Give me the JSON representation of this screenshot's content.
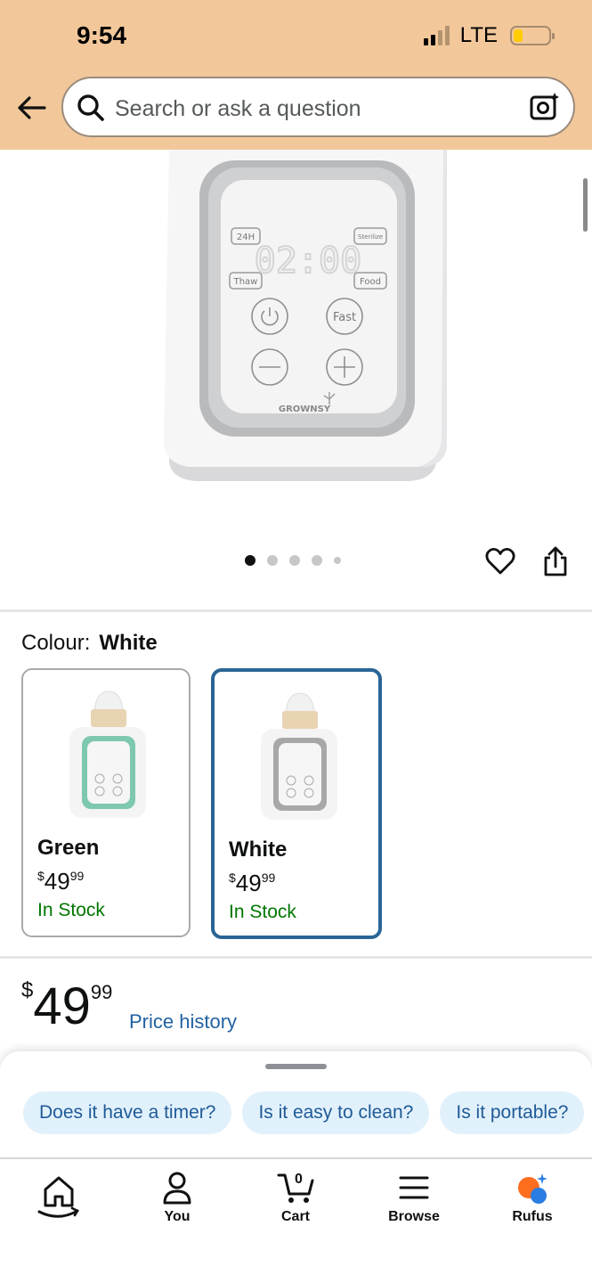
{
  "status_bar": {
    "time": "9:54",
    "network": "LTE"
  },
  "search": {
    "placeholder": "Search or ask a question"
  },
  "product_image": {
    "brand": "GROWNSY",
    "panel_labels": [
      "24H",
      "Sterilize",
      "Thaw",
      "Food"
    ],
    "display": "02:00",
    "fast_label": "Fast",
    "carousel_count": 5,
    "carousel_active": 0
  },
  "colour": {
    "label": "Colour:",
    "selected": "White",
    "options": [
      {
        "name": "Green",
        "price_currency": "$",
        "price_whole": "49",
        "price_cents": "99",
        "stock": "In Stock",
        "accent": "#7fc8b0"
      },
      {
        "name": "White",
        "price_currency": "$",
        "price_whole": "49",
        "price_cents": "99",
        "stock": "In Stock",
        "accent": "#a8a8a8"
      }
    ]
  },
  "price": {
    "currency": "$",
    "whole": "49",
    "cents": "99",
    "history_link": "Price history"
  },
  "rufus": {
    "suggestions": [
      "Does it have a timer?",
      "Is it easy to clean?",
      "Is it portable?"
    ]
  },
  "nav": {
    "home": "",
    "you": "You",
    "cart": "Cart",
    "cart_count": "0",
    "browse": "Browse",
    "rufus": "Rufus"
  },
  "colors": {
    "header": "#f2c89b",
    "selected_border": "#2a6596",
    "in_stock": "#007600",
    "link": "#2162a1",
    "chip_bg": "#e1f1fc"
  }
}
